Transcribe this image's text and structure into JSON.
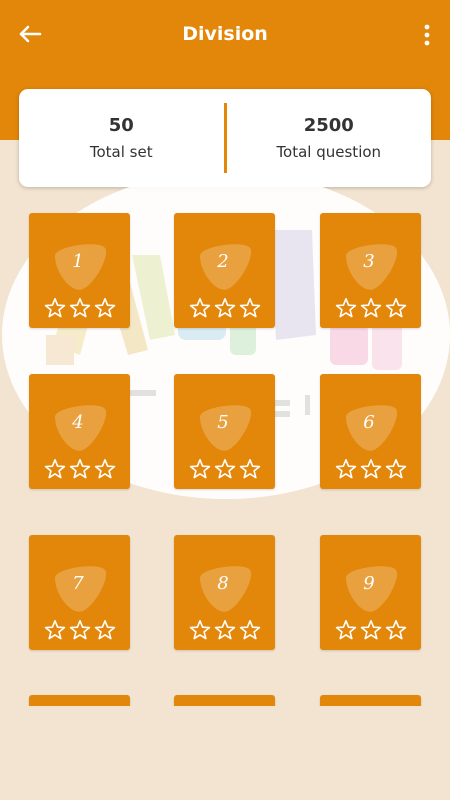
{
  "header": {
    "title": "Division",
    "back_icon": "arrow-left-icon",
    "menu_icon": "more-vert-icon",
    "color": "#e3870a"
  },
  "stats": {
    "total_set_value": "50",
    "total_set_label": "Total set",
    "total_question_value": "2500",
    "total_question_label": "Total question"
  },
  "levels": [
    {
      "number": "1",
      "stars": 0
    },
    {
      "number": "2",
      "stars": 0
    },
    {
      "number": "3",
      "stars": 0
    },
    {
      "number": "4",
      "stars": 0
    },
    {
      "number": "5",
      "stars": 0
    },
    {
      "number": "6",
      "stars": 0
    },
    {
      "number": "7",
      "stars": 0
    },
    {
      "number": "8",
      "stars": 0
    },
    {
      "number": "9",
      "stars": 0
    },
    {
      "number": "",
      "stars": 0
    },
    {
      "number": "",
      "stars": 0
    },
    {
      "number": "",
      "stars": 0
    }
  ],
  "theme": {
    "accent": "#e3870a",
    "background": "#f2e4d0",
    "card": "#ffffff"
  }
}
